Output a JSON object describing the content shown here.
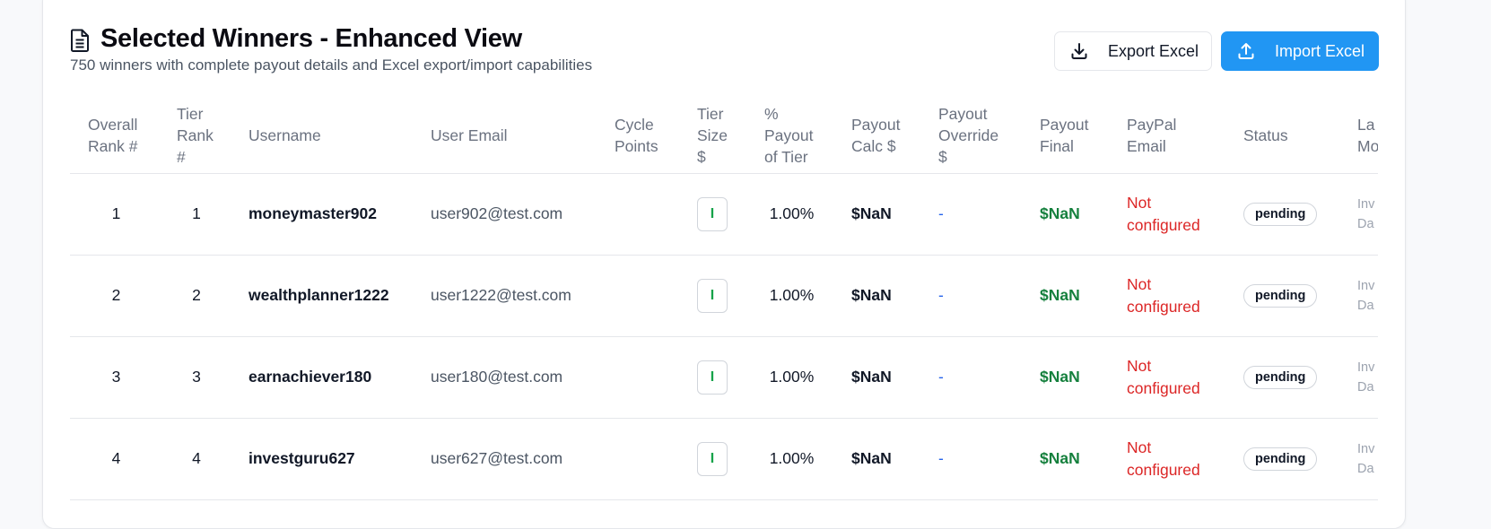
{
  "header": {
    "title": "Selected Winners - Enhanced View",
    "subtitle": "750 winners with complete payout details and Excel export/import capabilities",
    "export_label": "Export Excel",
    "import_label": "Import Excel"
  },
  "colors": {
    "accent": "#2196f3",
    "final_payout": "#15803d",
    "not_configured": "#dc2626",
    "override": "#2563eb"
  },
  "columns": [
    {
      "line1": "Overall",
      "line2": "Rank #",
      "line3": ""
    },
    {
      "line1": "Tier",
      "line2": "Rank",
      "line3": "#"
    },
    {
      "line1": "Username",
      "line2": "",
      "line3": ""
    },
    {
      "line1": "User Email",
      "line2": "",
      "line3": ""
    },
    {
      "line1": "Cycle",
      "line2": "Points",
      "line3": ""
    },
    {
      "line1": "Tier",
      "line2": "Size",
      "line3": "$"
    },
    {
      "line1": "%",
      "line2": "Payout",
      "line3": "of Tier"
    },
    {
      "line1": "Payout",
      "line2": "Calc $",
      "line3": ""
    },
    {
      "line1": "Payout",
      "line2": "Override",
      "line3": "$"
    },
    {
      "line1": "Payout",
      "line2": "Final",
      "line3": ""
    },
    {
      "line1": "PayPal",
      "line2": "Email",
      "line3": ""
    },
    {
      "line1": "Status",
      "line2": "",
      "line3": ""
    },
    {
      "line1": "La",
      "line2": "Mo",
      "line3": ""
    }
  ],
  "rows": [
    {
      "overall_rank": "1",
      "tier_rank": "1",
      "username": "moneymaster902",
      "email": "user902@test.com",
      "cycle_points": "",
      "tier_size": "I",
      "payout_pct": "1.00%",
      "payout_calc": "$NaN",
      "payout_override": "-",
      "payout_final": "$NaN",
      "paypal_line1": "Not",
      "paypal_line2": "configured",
      "status": "pending",
      "lastmod_line1": "Inv",
      "lastmod_line2": "Da"
    },
    {
      "overall_rank": "2",
      "tier_rank": "2",
      "username": "wealthplanner1222",
      "email": "user1222@test.com",
      "cycle_points": "",
      "tier_size": "I",
      "payout_pct": "1.00%",
      "payout_calc": "$NaN",
      "payout_override": "-",
      "payout_final": "$NaN",
      "paypal_line1": "Not",
      "paypal_line2": "configured",
      "status": "pending",
      "lastmod_line1": "Inv",
      "lastmod_line2": "Da"
    },
    {
      "overall_rank": "3",
      "tier_rank": "3",
      "username": "earnachiever180",
      "email": "user180@test.com",
      "cycle_points": "",
      "tier_size": "I",
      "payout_pct": "1.00%",
      "payout_calc": "$NaN",
      "payout_override": "-",
      "payout_final": "$NaN",
      "paypal_line1": "Not",
      "paypal_line2": "configured",
      "status": "pending",
      "lastmod_line1": "Inv",
      "lastmod_line2": "Da"
    },
    {
      "overall_rank": "4",
      "tier_rank": "4",
      "username": "investguru627",
      "email": "user627@test.com",
      "cycle_points": "",
      "tier_size": "I",
      "payout_pct": "1.00%",
      "payout_calc": "$NaN",
      "payout_override": "-",
      "payout_final": "$NaN",
      "paypal_line1": "Not",
      "paypal_line2": "configured",
      "status": "pending",
      "lastmod_line1": "Inv",
      "lastmod_line2": "Da"
    }
  ]
}
